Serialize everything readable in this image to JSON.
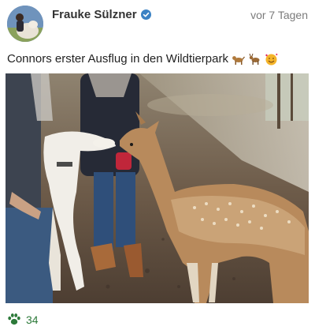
{
  "post": {
    "author": "Frauke Sülzner",
    "time": "vor 7 Tagen",
    "caption": "Connors erster Ausflug in den Wildtierpark",
    "caption_emojis": [
      "dog-emoji",
      "deer-emoji",
      "smiling-face-with-hearts-emoji"
    ],
    "likes": "34",
    "accent_color": "#2d7a3a",
    "verified_color": "#3b82c4"
  }
}
